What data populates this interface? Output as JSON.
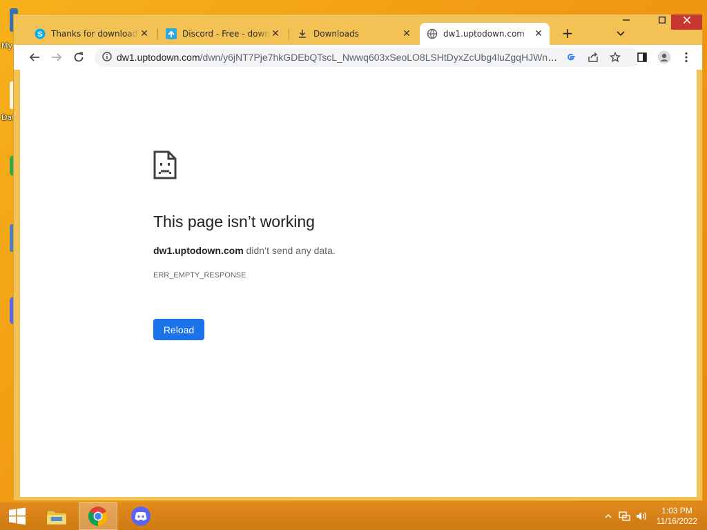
{
  "desktop": {
    "icon_labels": [
      "My",
      "Dat"
    ]
  },
  "tabs": [
    {
      "title": "Thanks for downloading",
      "icon": "skype-icon",
      "active": false
    },
    {
      "title": "Discord - Free - download",
      "icon": "uptodown-icon",
      "active": false
    },
    {
      "title": "Downloads",
      "icon": "download-icon",
      "active": false
    },
    {
      "title": "dw1.uptodown.com",
      "icon": "globe-icon",
      "active": true
    }
  ],
  "omnibox": {
    "host": "dw1.uptodown.com",
    "path": "/dwn/y6jNT7Pje7hkGDEbQTscL_Nwwq603xSeoLO8LSHtDyxZcUbg4luZgqHJWnMh..."
  },
  "error_page": {
    "title": "This page isn’t working",
    "host": "dw1.uptodown.com",
    "message": " didn’t send any data.",
    "code": "ERR_EMPTY_RESPONSE",
    "reload_label": "Reload"
  },
  "taskbar": {
    "apps": [
      "file-explorer-icon",
      "chrome-icon",
      "discord-icon"
    ],
    "clock_time": "1:03 PM",
    "clock_date": "11/16/2022"
  },
  "colors": {
    "accent": "#1a73e8",
    "desktop": "#f29a12",
    "tabstrip": "#f3c255"
  }
}
